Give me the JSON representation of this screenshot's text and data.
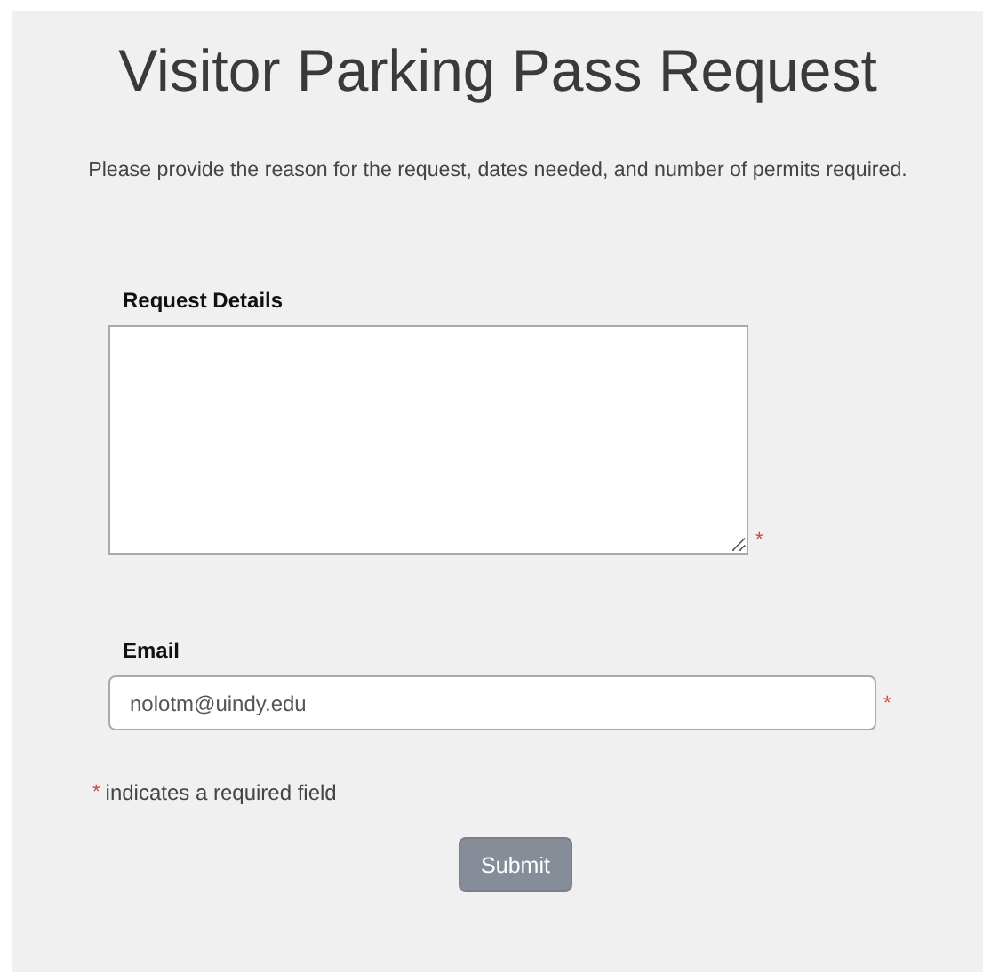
{
  "title": "Visitor Parking Pass Request",
  "instructions": "Please provide the reason for the request, dates needed, and number of permits required.",
  "fields": [
    {
      "kind": "textarea",
      "label": "Request Details",
      "required_mark": "*"
    },
    {
      "kind": "text",
      "label": "Email",
      "value": "nolotm@uindy.edu",
      "required_mark": "*"
    }
  ],
  "required_note": {
    "mark": "*",
    "text": "indicates a required field"
  },
  "submit": {
    "label": "Submit",
    "disabled": true
  }
}
